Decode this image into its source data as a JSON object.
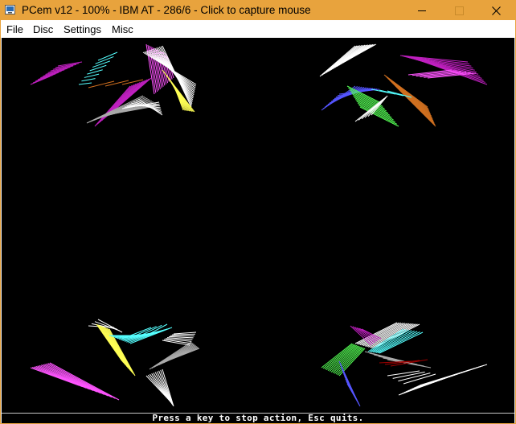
{
  "window": {
    "title": "PCem v12 - 100% - IBM AT - 286/6 - Click to capture mouse",
    "titlebar_color": "#e8a33d"
  },
  "titlebar_buttons": [
    {
      "name": "minimize-button",
      "icon": "minimize-icon"
    },
    {
      "name": "maximize-button",
      "icon": "maximize-icon",
      "state": "disabled"
    },
    {
      "name": "close-button",
      "icon": "close-icon"
    }
  ],
  "menubar": {
    "items": [
      "File",
      "Disc",
      "Settings",
      "Misc"
    ]
  },
  "screen": {
    "background": "#000000",
    "status_message": "Press a key to stop action, Esc quits.",
    "palette": {
      "magenta": "#c020c0",
      "lightmagenta": "#ff55ff",
      "cyan": "#55ffff",
      "white": "#ffffff",
      "gray": "#aaaaaa",
      "yellow": "#ffff55",
      "orange": "#d07020",
      "blue": "#5555ff",
      "green": "#55ff55",
      "red": "#a00000"
    }
  }
}
